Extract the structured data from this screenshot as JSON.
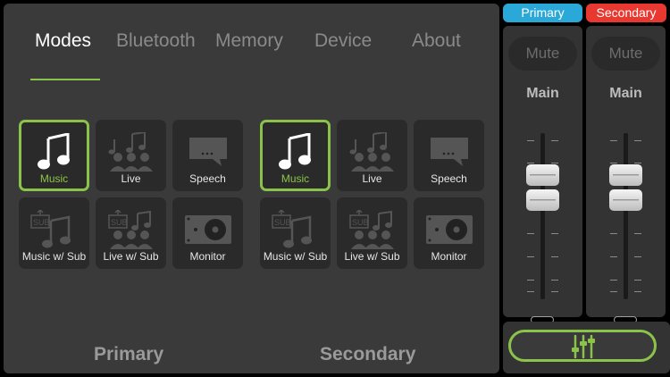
{
  "tabs": [
    {
      "label": "Modes"
    },
    {
      "label": "Bluetooth"
    },
    {
      "label": "Memory"
    },
    {
      "label": "Device"
    },
    {
      "label": "About"
    }
  ],
  "modes": {
    "primary": {
      "label": "Primary",
      "tiles": [
        {
          "label": "Music",
          "icon": "music-note-icon",
          "selected": true
        },
        {
          "label": "Live",
          "icon": "live-crowd-icon",
          "selected": false
        },
        {
          "label": "Speech",
          "icon": "speech-bubble-icon",
          "selected": false
        },
        {
          "label": "Music w/ Sub",
          "icon": "music-sub-icon",
          "selected": false
        },
        {
          "label": "Live w/ Sub",
          "icon": "live-sub-icon",
          "selected": false
        },
        {
          "label": "Monitor",
          "icon": "monitor-speaker-icon",
          "selected": false
        }
      ]
    },
    "secondary": {
      "label": "Secondary",
      "tiles": [
        {
          "label": "Music",
          "icon": "music-note-icon",
          "selected": true
        },
        {
          "label": "Live",
          "icon": "live-crowd-icon",
          "selected": false
        },
        {
          "label": "Speech",
          "icon": "speech-bubble-icon",
          "selected": false
        },
        {
          "label": "Music w/ Sub",
          "icon": "music-sub-icon",
          "selected": false
        },
        {
          "label": "Live w/ Sub",
          "icon": "live-sub-icon",
          "selected": false
        },
        {
          "label": "Monitor",
          "icon": "monitor-speaker-icon",
          "selected": false
        }
      ]
    }
  },
  "channels": {
    "primary": {
      "badge": "Primary",
      "badge_color": "#2aa8d8",
      "mute": "Mute",
      "label": "Main"
    },
    "secondary": {
      "badge": "Secondary",
      "badge_color": "#e8382f",
      "mute": "Mute",
      "label": "Main"
    }
  },
  "colors": {
    "accent": "#8bc34a"
  }
}
